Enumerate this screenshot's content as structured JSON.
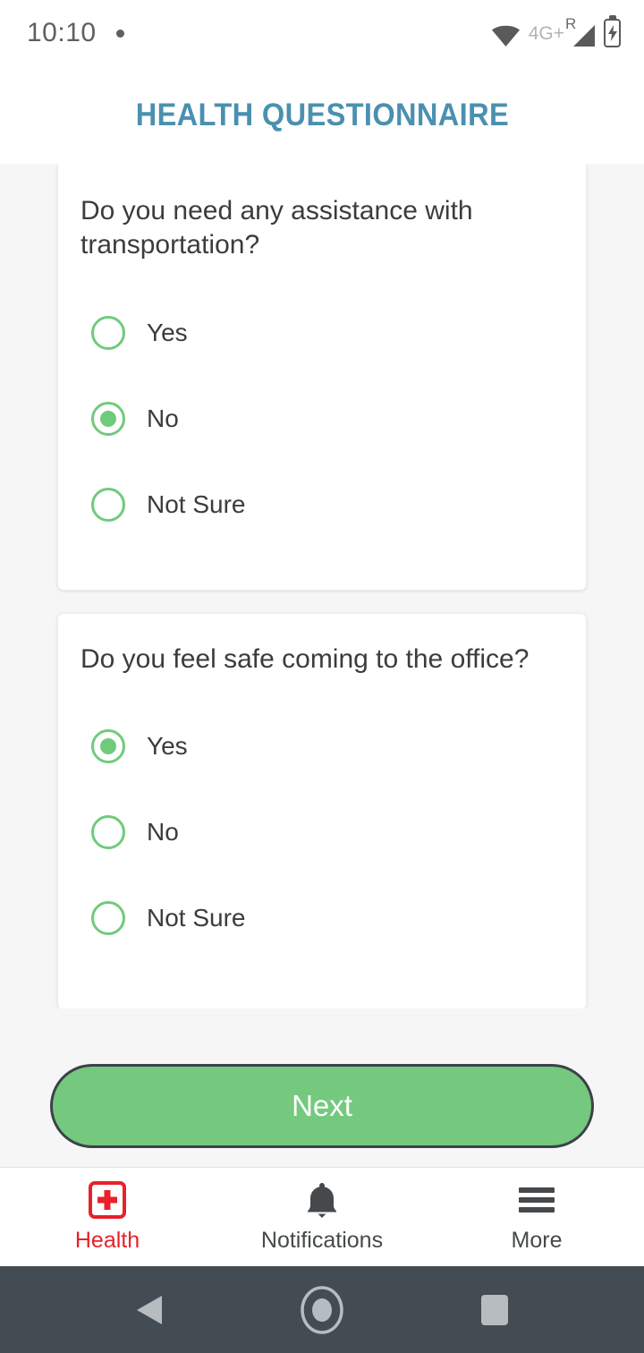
{
  "status_bar": {
    "time": "10:10",
    "notification_dot": "•",
    "wifi_icon": "wifi-icon",
    "network_label": "4G+",
    "roaming_label": "R",
    "signal_icon": "signal-triangle-icon",
    "battery_icon": "battery-charging-icon"
  },
  "header": {
    "title": "HEALTH QUESTIONNAIRE",
    "title_color": "#4a90b0"
  },
  "questions": [
    {
      "text": "Do you need any assistance with transportation?",
      "options": [
        {
          "label": "Yes",
          "selected": false
        },
        {
          "label": "No",
          "selected": true
        },
        {
          "label": "Not Sure",
          "selected": false
        }
      ]
    },
    {
      "text": "Do you feel safe coming to the office?",
      "options": [
        {
          "label": "Yes",
          "selected": true
        },
        {
          "label": "No",
          "selected": false
        },
        {
          "label": "Not Sure",
          "selected": false
        }
      ]
    }
  ],
  "primary_action": {
    "label": "Next",
    "fill_color": "#74c97f",
    "border_color": "#3c4248",
    "text_color": "#ffffff"
  },
  "tab_bar": {
    "active_color": "#e8212a",
    "inactive_color": "#46494b",
    "tabs": [
      {
        "label": "Health",
        "icon": "medical-cross-icon",
        "active": true
      },
      {
        "label": "Notifications",
        "icon": "bell-icon",
        "active": false
      },
      {
        "label": "More",
        "icon": "hamburger-menu-icon",
        "active": false
      }
    ]
  },
  "android_nav": {
    "background_color": "#434c53",
    "back_icon": "back-triangle-icon",
    "home_icon": "home-circle-icon",
    "recents_icon": "recents-square-icon"
  },
  "theme": {
    "page_background": "#f6f6f6",
    "card_background": "#ffffff",
    "radio_color": "#6fcb7c",
    "text_color": "#3c3c3c"
  }
}
